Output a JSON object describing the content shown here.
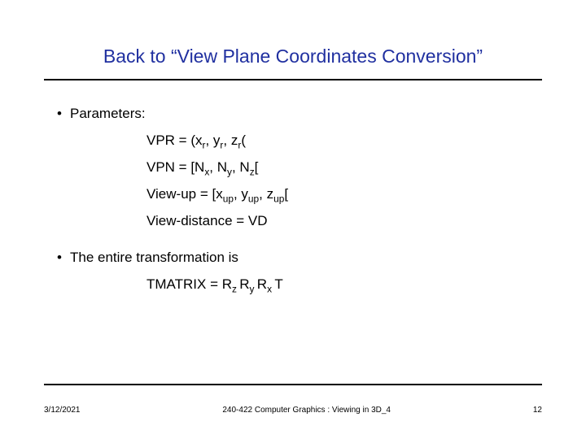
{
  "title": "Back to “View Plane Coordinates Conversion”",
  "bullets": {
    "b1": "Parameters:",
    "b2": "The entire transformation is"
  },
  "params": {
    "vpr": {
      "label": "VPR = (x",
      "s1": "r",
      "m1": ", y",
      "s2": "r",
      "m2": ", z",
      "s3": "r",
      "close": "("
    },
    "vpn": {
      "label": "VPN = [N",
      "s1": "x",
      "m1": ", N",
      "s2": "y",
      "m2": ", N",
      "s3": "z",
      "close": "["
    },
    "vup": {
      "label": "View-up = [x",
      "s1": "up",
      "m1": ", y",
      "s2": "up",
      "m2": ", z",
      "s3": "up",
      "close": "["
    },
    "vd": {
      "text": "View-distance = VD"
    }
  },
  "tmatrix": {
    "lead": "TMATRIX = R",
    "s1": "z ",
    "m1": "R",
    "s2": "y ",
    "m2": "R",
    "s3": "x ",
    "tail": "T"
  },
  "footer": {
    "date": "3/12/2021",
    "course": "240-422 Computer Graphics : Viewing in 3D_4",
    "page": "12"
  }
}
